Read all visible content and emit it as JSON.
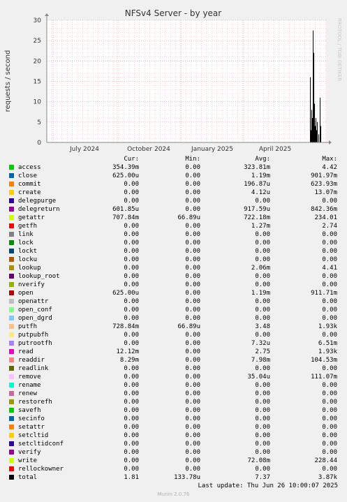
{
  "chart_data": {
    "type": "area",
    "title": "NFSv4 Server - by year",
    "ylabel": "requests / second",
    "ylim": [
      0,
      30
    ],
    "yticks": [
      0,
      5,
      10,
      15,
      20,
      25,
      30
    ],
    "xtick_labels": [
      "July 2024",
      "October 2024",
      "January 2025",
      "April 2025"
    ],
    "grid": true,
    "watermark": "RRDTOOL / TOBI OETIKER",
    "peaks": [
      16,
      27.5,
      11
    ],
    "series_colors": {
      "access": "#00cc00",
      "close": "#0066b3",
      "commit": "#ff8000",
      "create": "#ffcc00",
      "delegpurge": "#330099",
      "delegreturn": "#990099",
      "getattr": "#ccff00",
      "getfh": "#ff0000",
      "link": "#808080",
      "lock": "#008f00",
      "lockt": "#00487d",
      "locku": "#b35a00",
      "lookup": "#b38f00",
      "lookup_root": "#6b006b",
      "nverify": "#8fb300",
      "open": "#b30000",
      "openattr": "#bebebe",
      "open_conf": "#80ff80",
      "open_dgrd": "#80c9ff",
      "putfh": "#ffc080",
      "putpubfh": "#ffe680",
      "putrootfh": "#aa80ff",
      "read": "#ee00cc",
      "readdir": "#ff8080",
      "readlink": "#666600",
      "remove": "#ffbfff",
      "rename": "#00ffcc",
      "renew": "#cc6699",
      "restorefh": "#999900",
      "savefh": "#00cc00",
      "secinfo": "#0066b3",
      "setattr": "#ff8000",
      "setcltid": "#ffcc00",
      "setcltidconf": "#330099",
      "verify": "#990099",
      "write": "#ccff00",
      "rellockowner": "#ff0000",
      "total": "#000000"
    },
    "legend_headers": [
      "Cur:",
      "Min:",
      "Avg:",
      "Max:"
    ],
    "legend": [
      {
        "name": "access",
        "cur": "354.39m",
        "min": "0.00",
        "avg": "323.81m",
        "max": "4.42"
      },
      {
        "name": "close",
        "cur": "625.00u",
        "min": "0.00",
        "avg": "1.19m",
        "max": "901.97m"
      },
      {
        "name": "commit",
        "cur": "0.00",
        "min": "0.00",
        "avg": "196.87u",
        "max": "623.93m"
      },
      {
        "name": "create",
        "cur": "0.00",
        "min": "0.00",
        "avg": "4.12u",
        "max": "13.07m"
      },
      {
        "name": "delegpurge",
        "cur": "0.00",
        "min": "0.00",
        "avg": "0.00",
        "max": "0.00"
      },
      {
        "name": "delegreturn",
        "cur": "601.85u",
        "min": "0.00",
        "avg": "917.59u",
        "max": "842.36m"
      },
      {
        "name": "getattr",
        "cur": "707.84m",
        "min": "66.89u",
        "avg": "722.18m",
        "max": "234.01"
      },
      {
        "name": "getfh",
        "cur": "0.00",
        "min": "0.00",
        "avg": "1.27m",
        "max": "2.74"
      },
      {
        "name": "link",
        "cur": "0.00",
        "min": "0.00",
        "avg": "0.00",
        "max": "0.00"
      },
      {
        "name": "lock",
        "cur": "0.00",
        "min": "0.00",
        "avg": "0.00",
        "max": "0.00"
      },
      {
        "name": "lockt",
        "cur": "0.00",
        "min": "0.00",
        "avg": "0.00",
        "max": "0.00"
      },
      {
        "name": "locku",
        "cur": "0.00",
        "min": "0.00",
        "avg": "0.00",
        "max": "0.00"
      },
      {
        "name": "lookup",
        "cur": "0.00",
        "min": "0.00",
        "avg": "2.06m",
        "max": "4.41"
      },
      {
        "name": "lookup_root",
        "cur": "0.00",
        "min": "0.00",
        "avg": "0.00",
        "max": "0.00"
      },
      {
        "name": "nverify",
        "cur": "0.00",
        "min": "0.00",
        "avg": "0.00",
        "max": "0.00"
      },
      {
        "name": "open",
        "cur": "625.00u",
        "min": "0.00",
        "avg": "1.19m",
        "max": "911.71m"
      },
      {
        "name": "openattr",
        "cur": "0.00",
        "min": "0.00",
        "avg": "0.00",
        "max": "0.00"
      },
      {
        "name": "open_conf",
        "cur": "0.00",
        "min": "0.00",
        "avg": "0.00",
        "max": "0.00"
      },
      {
        "name": "open_dgrd",
        "cur": "0.00",
        "min": "0.00",
        "avg": "0.00",
        "max": "0.00"
      },
      {
        "name": "putfh",
        "cur": "728.84m",
        "min": "66.89u",
        "avg": "3.48",
        "max": "1.93k"
      },
      {
        "name": "putpubfh",
        "cur": "0.00",
        "min": "0.00",
        "avg": "0.00",
        "max": "0.00"
      },
      {
        "name": "putrootfh",
        "cur": "0.00",
        "min": "0.00",
        "avg": "7.32u",
        "max": "6.51m"
      },
      {
        "name": "read",
        "cur": "12.12m",
        "min": "0.00",
        "avg": "2.75",
        "max": "1.93k"
      },
      {
        "name": "readdir",
        "cur": "8.29m",
        "min": "0.00",
        "avg": "7.98m",
        "max": "104.53m"
      },
      {
        "name": "readlink",
        "cur": "0.00",
        "min": "0.00",
        "avg": "0.00",
        "max": "0.00"
      },
      {
        "name": "remove",
        "cur": "0.00",
        "min": "0.00",
        "avg": "35.04u",
        "max": "111.07m"
      },
      {
        "name": "rename",
        "cur": "0.00",
        "min": "0.00",
        "avg": "0.00",
        "max": "0.00"
      },
      {
        "name": "renew",
        "cur": "0.00",
        "min": "0.00",
        "avg": "0.00",
        "max": "0.00"
      },
      {
        "name": "restorefh",
        "cur": "0.00",
        "min": "0.00",
        "avg": "0.00",
        "max": "0.00"
      },
      {
        "name": "savefh",
        "cur": "0.00",
        "min": "0.00",
        "avg": "0.00",
        "max": "0.00"
      },
      {
        "name": "secinfo",
        "cur": "0.00",
        "min": "0.00",
        "avg": "0.00",
        "max": "0.00"
      },
      {
        "name": "setattr",
        "cur": "0.00",
        "min": "0.00",
        "avg": "0.00",
        "max": "0.00"
      },
      {
        "name": "setcltid",
        "cur": "0.00",
        "min": "0.00",
        "avg": "0.00",
        "max": "0.00"
      },
      {
        "name": "setcltidconf",
        "cur": "0.00",
        "min": "0.00",
        "avg": "0.00",
        "max": "0.00"
      },
      {
        "name": "verify",
        "cur": "0.00",
        "min": "0.00",
        "avg": "0.00",
        "max": "0.00"
      },
      {
        "name": "write",
        "cur": "0.00",
        "min": "0.00",
        "avg": "72.08m",
        "max": "228.44"
      },
      {
        "name": "rellockowner",
        "cur": "0.00",
        "min": "0.00",
        "avg": "0.00",
        "max": "0.00"
      },
      {
        "name": "total",
        "cur": "1.81",
        "min": "133.78u",
        "avg": "7.37",
        "max": "3.87k"
      }
    ],
    "last_update": "Last update: Thu Jun 26 10:00:07 2025",
    "version": "Munin 2.0.76"
  }
}
